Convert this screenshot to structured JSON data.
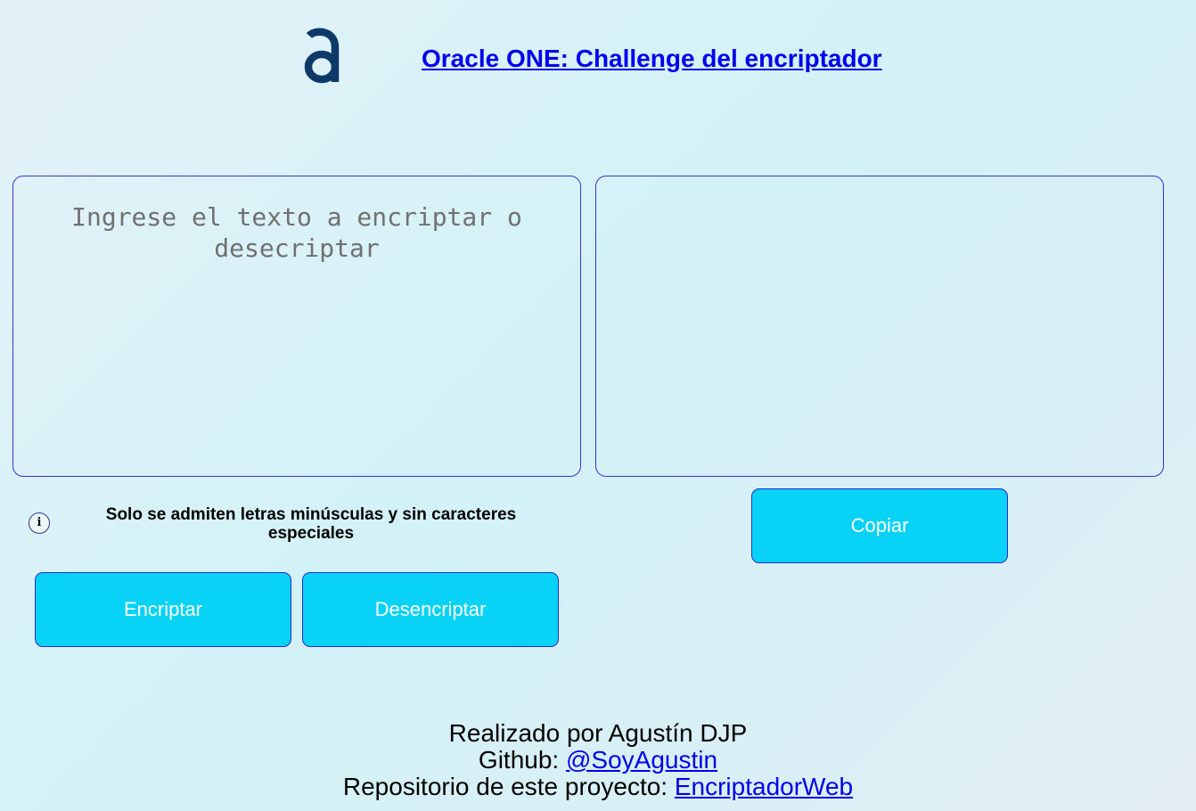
{
  "header": {
    "logo_icon": "alura-logo-icon",
    "logo_color": "#0d3968",
    "title": "Oracle ONE: Challenge del encriptador"
  },
  "input": {
    "placeholder": "Ingrese el texto a encriptar o desecriptar",
    "value": ""
  },
  "output": {
    "value": ""
  },
  "info": {
    "icon": "info-icon",
    "text": "Solo se admiten letras minúsculas y sin caracteres especiales"
  },
  "buttons": {
    "encrypt_label": "Encriptar",
    "decrypt_label": "Desencriptar",
    "copy_label": "Copiar"
  },
  "footer": {
    "line1": "Realizado por Agustín DJP",
    "github_prefix": "Github: ",
    "github_link": "@SoyAgustin",
    "repo_prefix": "Repositorio de este proyecto: ",
    "repo_link": "EncriptadorWeb"
  },
  "colors": {
    "accent": "#08d2f6",
    "border": "#3b2fd6",
    "link": "#0000ee"
  }
}
